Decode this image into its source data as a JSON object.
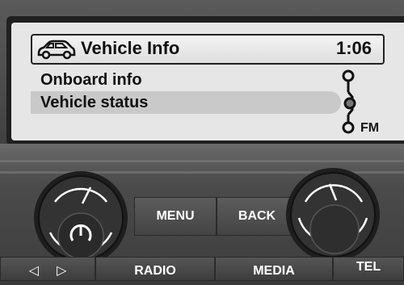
{
  "header": {
    "title": "Vehicle Info",
    "time": "1:06",
    "icon": "car-icon"
  },
  "menu": {
    "items": [
      {
        "label": "Onboard info",
        "selected": false
      },
      {
        "label": "Vehicle status",
        "selected": true
      }
    ]
  },
  "band": {
    "label": "FM",
    "icon": "band-selector-icon"
  },
  "buttons": {
    "menu": "MENU",
    "back": "BACK",
    "radio": "RADIO",
    "media": "MEDIA",
    "tel": "TEL",
    "prev_icon": "◁",
    "next_icon": "▷"
  },
  "colors": {
    "screen_bg": "#e6e6e6",
    "selection": "#c9c9c9",
    "panel": "#4b4b4b"
  }
}
